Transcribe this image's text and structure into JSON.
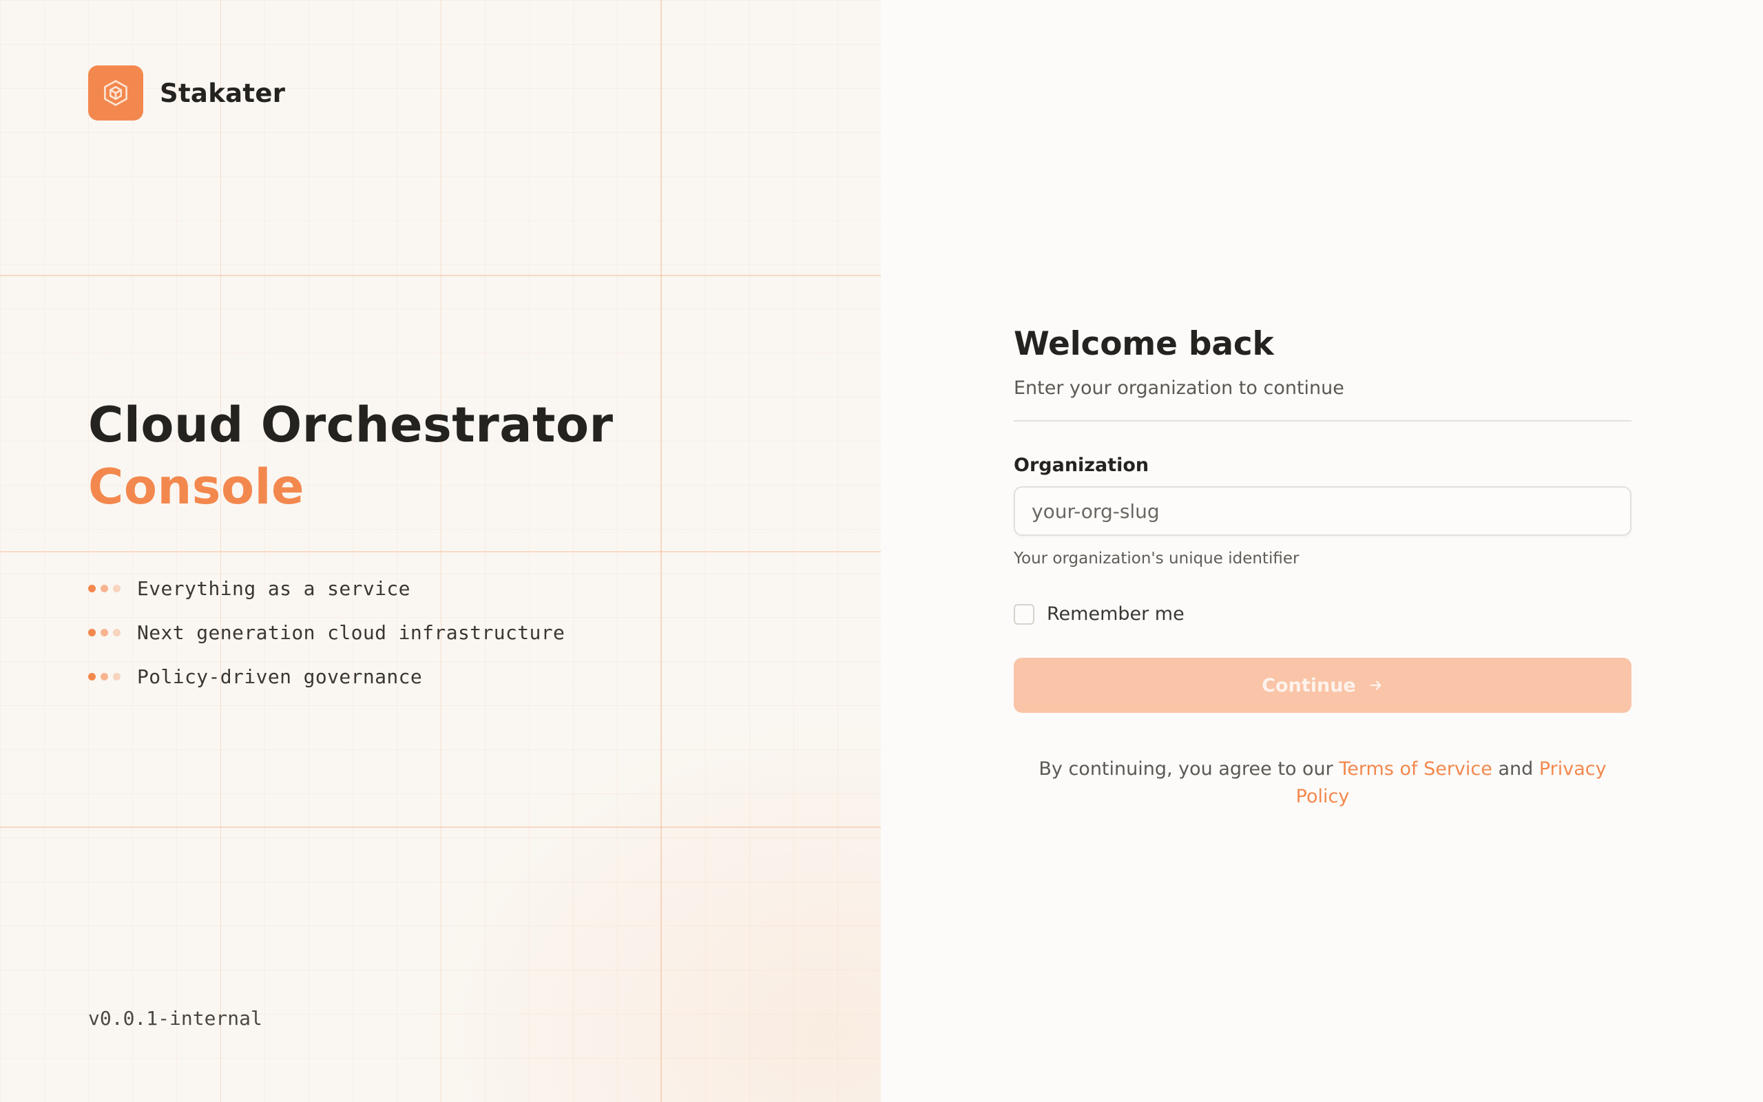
{
  "brand": {
    "name": "Stakater",
    "logo_icon": "cube-icon",
    "accent_color": "#f3884e"
  },
  "hero": {
    "title_line1": "Cloud Orchestrator",
    "title_line2": "Console",
    "features": [
      "Everything as a service",
      "Next generation cloud infrastructure",
      "Policy-driven governance"
    ],
    "version": "v0.0.1-internal"
  },
  "login": {
    "title": "Welcome back",
    "subtitle": "Enter your organization to continue",
    "organization_label": "Organization",
    "organization_value": "",
    "organization_placeholder": "your-org-slug",
    "organization_help": "Your organization's unique identifier",
    "remember_label": "Remember me",
    "remember_checked": false,
    "continue_label": "Continue",
    "continue_icon": "arrow-right-icon",
    "legal_prefix": "By continuing, you agree to our",
    "terms_label": "Terms of Service",
    "legal_and": "and",
    "privacy_label": "Privacy Policy"
  }
}
